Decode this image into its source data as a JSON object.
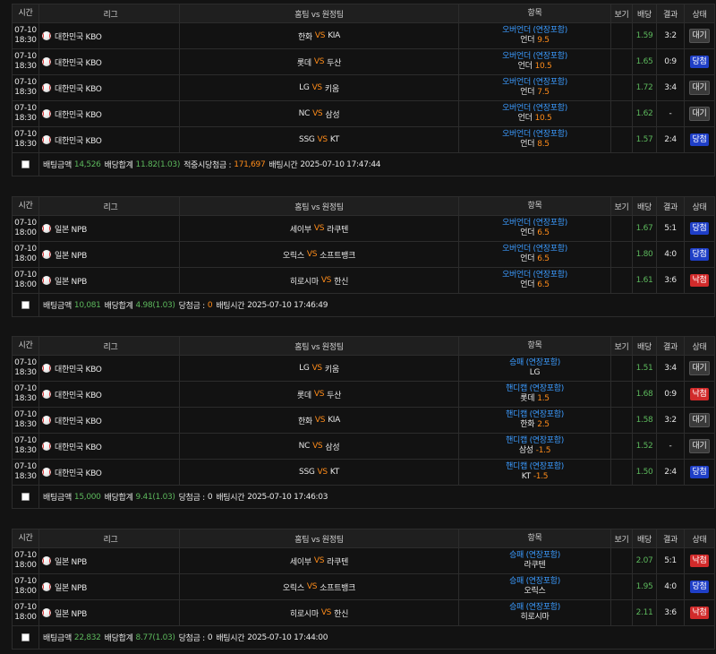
{
  "headers": {
    "time": "시간",
    "league": "리그",
    "match": "홈팀 vs 원정팀",
    "item": "항목",
    "view": "보기",
    "odds": "배당",
    "result": "결과",
    "status": "상태"
  },
  "vs_label": "VS",
  "colors": {
    "accent_orange": "#ff8c1a",
    "market_blue": "#3b9bff",
    "odds_green": "#5cb85c",
    "win_blue": "#1f3fc7",
    "lose_red": "#d12b2b"
  },
  "icons": {
    "sport": "baseball-icon",
    "select": "checkbox-icon"
  },
  "slips": [
    {
      "games": [
        {
          "date": "07-10",
          "time": "18:30",
          "league": "대한민국 KBO",
          "home": "한화",
          "away": "KIA",
          "market": "오버언더 (연장포함)",
          "pick": "언더",
          "point": "9.5",
          "odds": "1.59",
          "result": "3:2",
          "status": "대기",
          "status_type": "pending"
        },
        {
          "date": "07-10",
          "time": "18:30",
          "league": "대한민국 KBO",
          "home": "롯데",
          "away": "두산",
          "market": "오버언더 (연장포함)",
          "pick": "언더",
          "point": "10.5",
          "odds": "1.65",
          "result": "0:9",
          "status": "당첨",
          "status_type": "win"
        },
        {
          "date": "07-10",
          "time": "18:30",
          "league": "대한민국 KBO",
          "home": "LG",
          "away": "키움",
          "market": "오버언더 (연장포함)",
          "pick": "언더",
          "point": "7.5",
          "odds": "1.72",
          "result": "3:4",
          "status": "대기",
          "status_type": "pending"
        },
        {
          "date": "07-10",
          "time": "18:30",
          "league": "대한민국 KBO",
          "home": "NC",
          "away": "삼성",
          "market": "오버언더 (연장포함)",
          "pick": "언더",
          "point": "10.5",
          "odds": "1.62",
          "result": "-",
          "status": "대기",
          "status_type": "pending"
        },
        {
          "date": "07-10",
          "time": "18:30",
          "league": "대한민국 KBO",
          "home": "SSG",
          "away": "KT",
          "market": "오버언더 (연장포함)",
          "pick": "언더",
          "point": "8.5",
          "odds": "1.57",
          "result": "2:4",
          "status": "당첨",
          "status_type": "win"
        }
      ],
      "summary": {
        "amount_label": "배팅금액",
        "amount": "14,526",
        "total_label": "배당합계",
        "total": "11.82(1.03)",
        "win_label": "적중시당첨금 :",
        "win": "171,697",
        "win_class": "num-o",
        "time_label": "배팅시간",
        "time": "2025-07-10 17:47:44"
      }
    },
    {
      "games": [
        {
          "date": "07-10",
          "time": "18:00",
          "league": "일본 NPB",
          "home": "세이부",
          "away": "라쿠텐",
          "market": "오버언더 (연장포함)",
          "pick": "언더",
          "point": "6.5",
          "odds": "1.67",
          "result": "5:1",
          "status": "당첨",
          "status_type": "win"
        },
        {
          "date": "07-10",
          "time": "18:00",
          "league": "일본 NPB",
          "home": "오릭스",
          "away": "소프트뱅크",
          "market": "오버언더 (연장포함)",
          "pick": "언더",
          "point": "6.5",
          "odds": "1.80",
          "result": "4:0",
          "status": "당첨",
          "status_type": "win"
        },
        {
          "date": "07-10",
          "time": "18:00",
          "league": "일본 NPB",
          "home": "히로시마",
          "away": "한신",
          "market": "오버언더 (연장포함)",
          "pick": "언더",
          "point": "6.5",
          "odds": "1.61",
          "result": "3:6",
          "status": "낙첨",
          "status_type": "lose"
        }
      ],
      "summary": {
        "amount_label": "배팅금액",
        "amount": "10,081",
        "total_label": "배당합계",
        "total": "4.98(1.03)",
        "win_label": "당첨금 :",
        "win": "0",
        "win_class": "num-o",
        "time_label": "배팅시간",
        "time": "2025-07-10 17:46:49"
      }
    },
    {
      "games": [
        {
          "date": "07-10",
          "time": "18:30",
          "league": "대한민국 KBO",
          "home": "LG",
          "away": "키움",
          "market": "승패 (연장포함)",
          "pick": "LG",
          "point": "",
          "odds": "1.51",
          "result": "3:4",
          "status": "대기",
          "status_type": "pending"
        },
        {
          "date": "07-10",
          "time": "18:30",
          "league": "대한민국 KBO",
          "home": "롯데",
          "away": "두산",
          "market": "핸디캡 (연장포함)",
          "pick": "롯데",
          "point": "1.5",
          "odds": "1.68",
          "result": "0:9",
          "status": "낙첨",
          "status_type": "lose"
        },
        {
          "date": "07-10",
          "time": "18:30",
          "league": "대한민국 KBO",
          "home": "한화",
          "away": "KIA",
          "market": "핸디캡 (연장포함)",
          "pick": "한화",
          "point": "2.5",
          "odds": "1.58",
          "result": "3:2",
          "status": "대기",
          "status_type": "pending"
        },
        {
          "date": "07-10",
          "time": "18:30",
          "league": "대한민국 KBO",
          "home": "NC",
          "away": "삼성",
          "market": "핸디캡 (연장포함)",
          "pick": "삼성",
          "point": "-1.5",
          "odds": "1.52",
          "result": "-",
          "status": "대기",
          "status_type": "pending"
        },
        {
          "date": "07-10",
          "time": "18:30",
          "league": "대한민국 KBO",
          "home": "SSG",
          "away": "KT",
          "market": "핸디캡 (연장포함)",
          "pick": "KT",
          "point": "-1.5",
          "odds": "1.50",
          "result": "2:4",
          "status": "당첨",
          "status_type": "win"
        }
      ],
      "summary": {
        "amount_label": "배팅금액",
        "amount": "15,000",
        "total_label": "배당합계",
        "total": "9.41(1.03)",
        "win_label": "당첨금 :",
        "win": "0",
        "win_class": "num-w",
        "time_label": "배팅시간",
        "time": "2025-07-10 17:46:03"
      }
    },
    {
      "games": [
        {
          "date": "07-10",
          "time": "18:00",
          "league": "일본 NPB",
          "home": "세이부",
          "away": "라쿠텐",
          "market": "승패 (연장포함)",
          "pick": "라쿠텐",
          "point": "",
          "odds": "2.07",
          "result": "5:1",
          "status": "낙첨",
          "status_type": "lose"
        },
        {
          "date": "07-10",
          "time": "18:00",
          "league": "일본 NPB",
          "home": "오릭스",
          "away": "소프트뱅크",
          "market": "승패 (연장포함)",
          "pick": "오릭스",
          "point": "",
          "odds": "1.95",
          "result": "4:0",
          "status": "당첨",
          "status_type": "win"
        },
        {
          "date": "07-10",
          "time": "18:00",
          "league": "일본 NPB",
          "home": "히로시마",
          "away": "한신",
          "market": "승패 (연장포함)",
          "pick": "히로시마",
          "point": "",
          "odds": "2.11",
          "result": "3:6",
          "status": "낙첨",
          "status_type": "lose"
        }
      ],
      "summary": {
        "amount_label": "배팅금액",
        "amount": "22,832",
        "total_label": "배당합계",
        "total": "8.77(1.03)",
        "win_label": "당첨금 :",
        "win": "0",
        "win_class": "num-w",
        "time_label": "배팅시간",
        "time": "2025-07-10 17:44:00"
      }
    }
  ]
}
